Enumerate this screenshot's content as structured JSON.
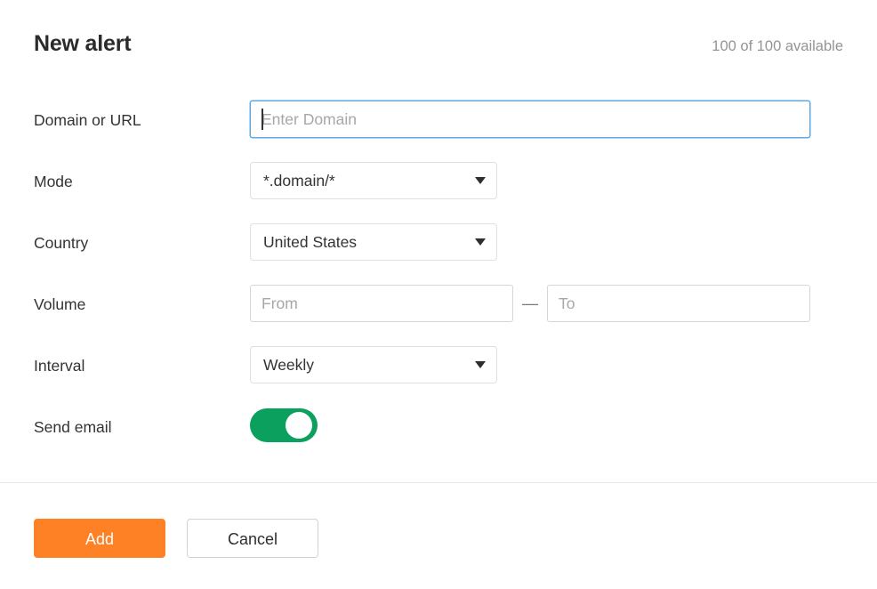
{
  "header": {
    "title": "New alert",
    "quota": "100 of 100 available"
  },
  "form": {
    "domain": {
      "label": "Domain or URL",
      "placeholder": "Enter Domain",
      "value": "",
      "focused": true
    },
    "mode": {
      "label": "Mode",
      "selected": "*.domain/*",
      "arrow_icon": "chevron-down-icon"
    },
    "country": {
      "label": "Country",
      "selected": "United States",
      "arrow_icon": "chevron-down-icon"
    },
    "volume": {
      "label": "Volume",
      "from_placeholder": "From",
      "from_value": "",
      "to_placeholder": "To",
      "to_value": "",
      "separator": "—"
    },
    "interval": {
      "label": "Interval",
      "selected": "Weekly",
      "arrow_icon": "chevron-down-icon"
    },
    "send_email": {
      "label": "Send email",
      "state": "on"
    }
  },
  "footer": {
    "add_label": "Add",
    "cancel_label": "Cancel"
  },
  "colors": {
    "primary_button": "#ff8126",
    "toggle_on": "#0ca05f",
    "focus_border": "#61a8e2",
    "label_text": "#333333",
    "muted_text": "#949494"
  }
}
